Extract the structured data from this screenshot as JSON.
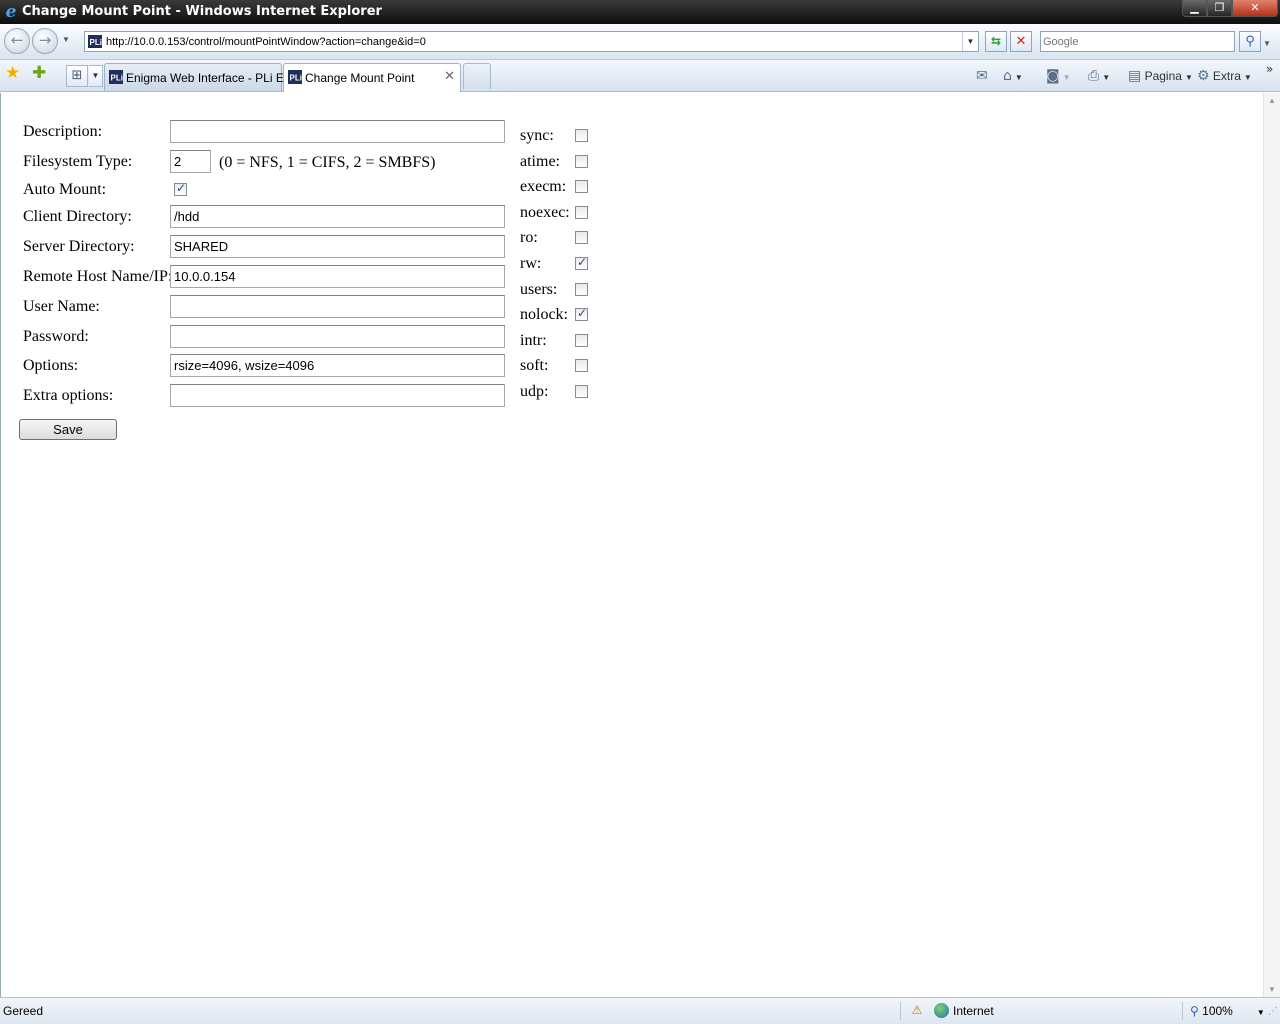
{
  "window": {
    "title": "Change Mount Point - Windows Internet Explorer",
    "minimize_glyph": "▁",
    "restore_glyph": "❐",
    "close_glyph": "✕"
  },
  "browser": {
    "address": "http://10.0.0.153/control/mountPointWindow?action=change&id=0",
    "search_placeholder": "Google",
    "tabs": [
      {
        "label": "Enigma Web Interface - PLi E...",
        "active": false
      },
      {
        "label": "Change Mount Point",
        "active": true
      }
    ],
    "commands": {
      "page_label": "Pagina",
      "tools_label": "Extra"
    }
  },
  "form": {
    "fields": {
      "description": {
        "label": "Description:",
        "value": ""
      },
      "fstype": {
        "label": "Filesystem Type:",
        "value": "2",
        "hint": "(0 = NFS, 1 = CIFS, 2 = SMBFS)"
      },
      "automount": {
        "label": "Auto Mount:",
        "checked": true
      },
      "client_dir": {
        "label": "Client Directory:",
        "value": "/hdd"
      },
      "server_dir": {
        "label": "Server Directory:",
        "value": "SHARED"
      },
      "remote_host": {
        "label": "Remote Host Name/IP:",
        "value": "10.0.0.154"
      },
      "username": {
        "label": "User Name:",
        "value": ""
      },
      "password": {
        "label": "Password:",
        "value": ""
      },
      "options": {
        "label": "Options:",
        "value": "rsize=4096, wsize=4096"
      },
      "extra_options": {
        "label": "Extra options:",
        "value": ""
      }
    },
    "save_label": "Save",
    "mount_options": [
      {
        "label": "sync:",
        "checked": false
      },
      {
        "label": "atime:",
        "checked": false
      },
      {
        "label": "execm:",
        "checked": false
      },
      {
        "label": "noexec:",
        "checked": false
      },
      {
        "label": "ro:",
        "checked": false
      },
      {
        "label": "rw:",
        "checked": true
      },
      {
        "label": "users:",
        "checked": false
      },
      {
        "label": "nolock:",
        "checked": true
      },
      {
        "label": "intr:",
        "checked": false
      },
      {
        "label": "soft:",
        "checked": false
      },
      {
        "label": "udp:",
        "checked": false
      }
    ]
  },
  "status": {
    "text": "Gereed",
    "zone": "Internet",
    "zoom": "100%"
  }
}
